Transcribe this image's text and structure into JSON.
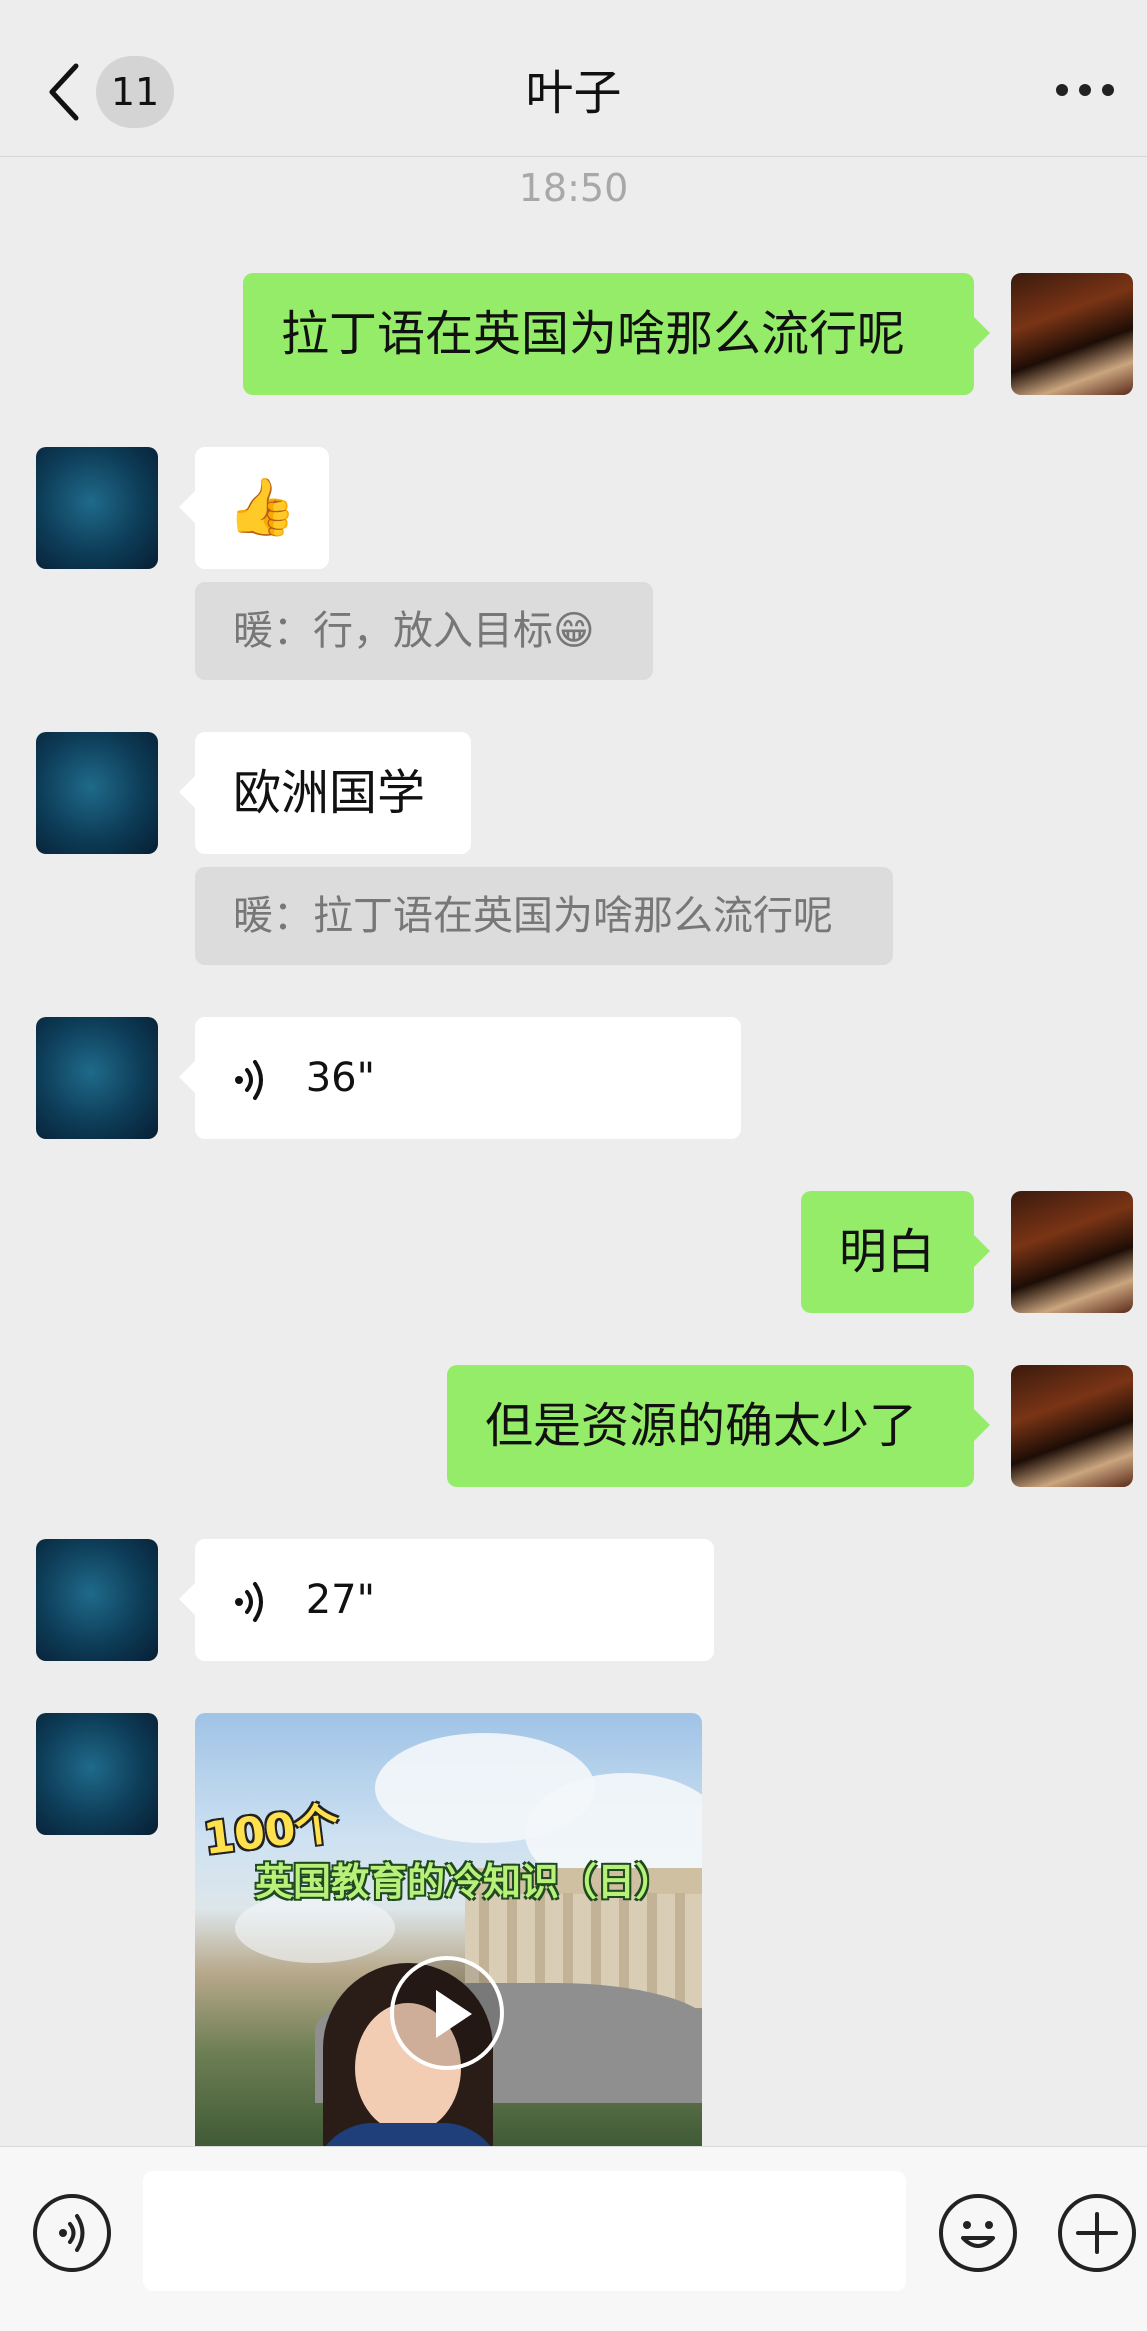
{
  "header": {
    "title": "叶子",
    "unread_count": "11"
  },
  "chat": {
    "timestamp": "18:50",
    "messages": [
      {
        "id": "m1",
        "side": "right",
        "type": "text",
        "text": "拉丁语在英国为啥那么流行呢"
      },
      {
        "id": "m2",
        "side": "left",
        "type": "emoji",
        "text": "👍",
        "quote": "暖：行，放入目标😁"
      },
      {
        "id": "m3",
        "side": "left",
        "type": "text",
        "text": "欧洲国学",
        "quote": "暖：拉丁语在英国为啥那么流行呢"
      },
      {
        "id": "m4",
        "side": "left",
        "type": "voice",
        "duration": "36\""
      },
      {
        "id": "m5",
        "side": "right",
        "type": "text",
        "text": "明白"
      },
      {
        "id": "m6",
        "side": "right",
        "type": "text",
        "text": "但是资源的确太少了"
      },
      {
        "id": "m7",
        "side": "left",
        "type": "voice",
        "duration": "27\""
      },
      {
        "id": "m8",
        "side": "left",
        "type": "video",
        "caption_line1": "100个",
        "caption_line2": "英国教育的冷知识（日）"
      }
    ]
  },
  "input": {
    "placeholder": ""
  },
  "icons": {
    "back": "chevron-left-icon",
    "more": "more-dots-icon",
    "voice": "voice-icon",
    "emoji": "emoji-icon",
    "plus": "plus-icon",
    "play": "play-icon"
  },
  "colors": {
    "background": "#ededed",
    "sent_bubble": "#95ec69",
    "received_bubble": "#ffffff",
    "quote_bubble": "#dcdcdc"
  }
}
